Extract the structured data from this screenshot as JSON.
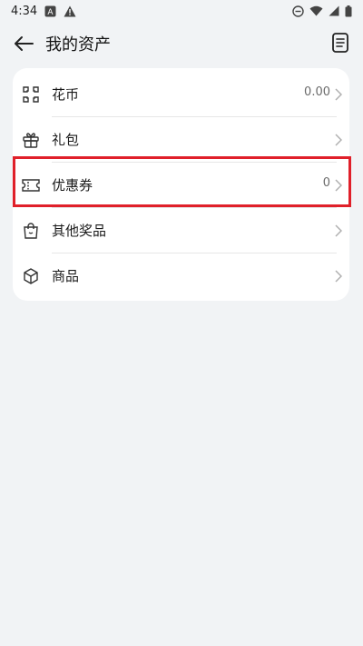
{
  "status_bar": {
    "time": "4:34",
    "icons": [
      "a-notification-icon",
      "warning-icon",
      "do-not-disturb-icon",
      "wifi-icon",
      "signal-icon",
      "battery-icon"
    ]
  },
  "header": {
    "title": "我的资产",
    "back_icon": "back-arrow-icon",
    "doc_icon": "document-list-icon"
  },
  "assets": {
    "items": [
      {
        "label": "花币",
        "value": "0.00",
        "icon": "flower-coin-icon"
      },
      {
        "label": "礼包",
        "value": "",
        "icon": "gift-icon"
      },
      {
        "label": "优惠券",
        "value": "0",
        "icon": "coupon-icon"
      },
      {
        "label": "其他奖品",
        "value": "",
        "icon": "shopping-bag-icon"
      },
      {
        "label": "商品",
        "value": "",
        "icon": "box-icon"
      }
    ]
  },
  "colors": {
    "background": "#f1f3f5",
    "card": "#ffffff",
    "highlight": "#e0202a"
  }
}
